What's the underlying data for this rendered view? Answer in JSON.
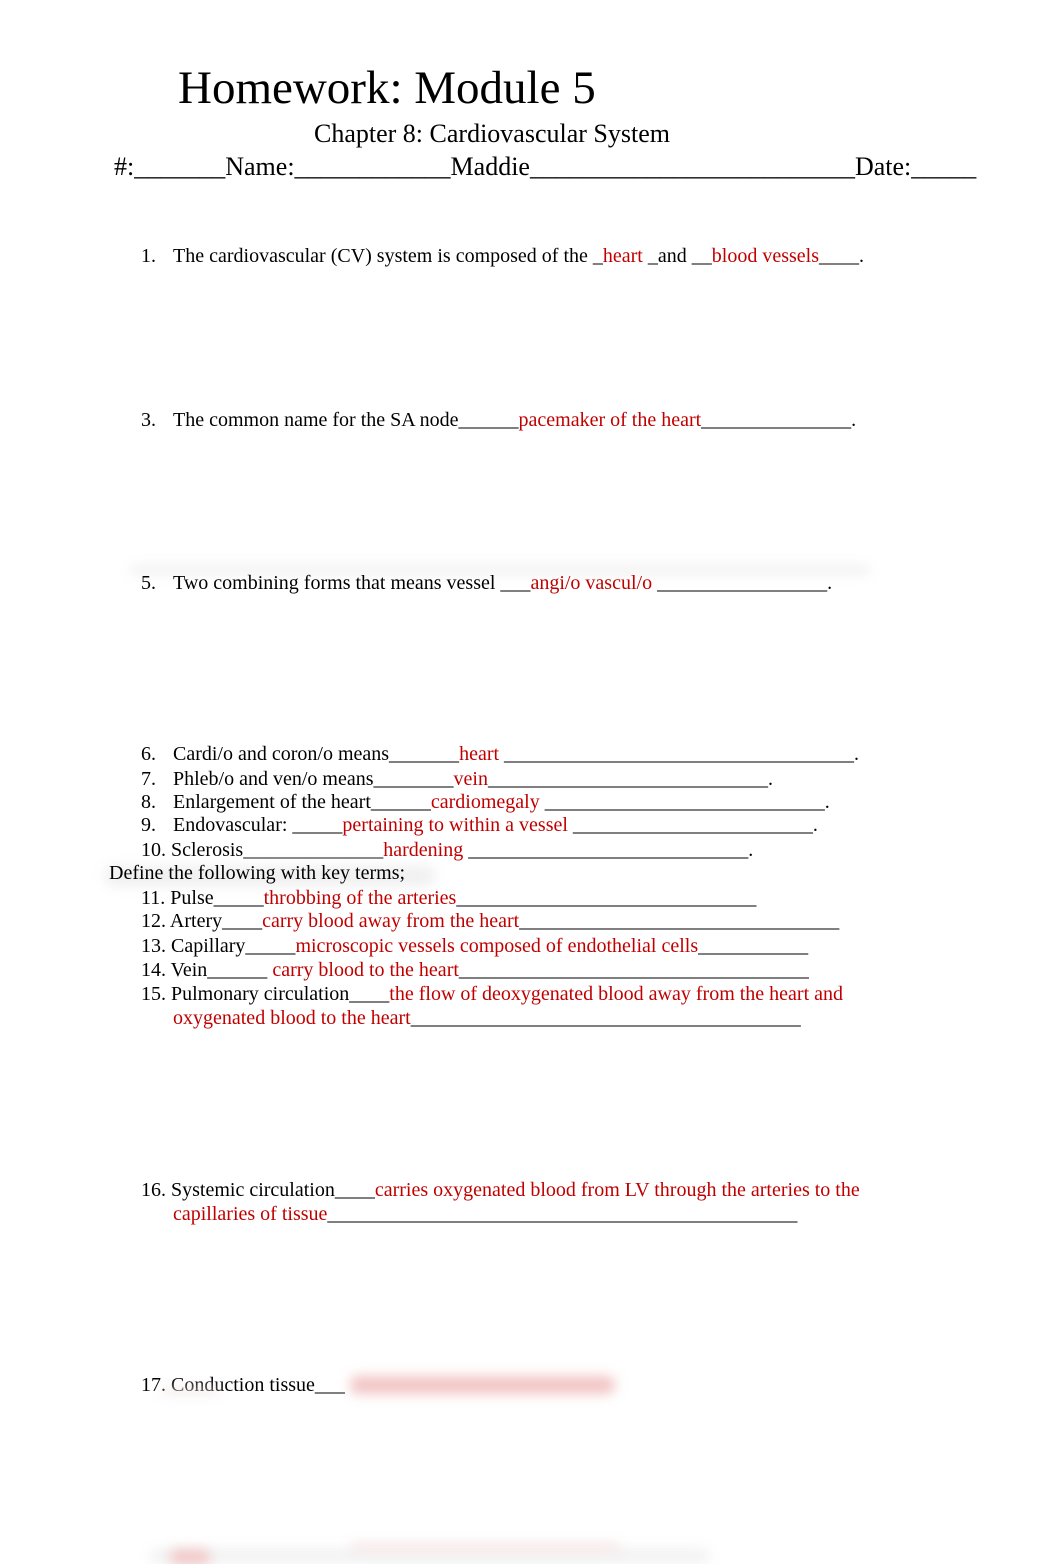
{
  "document": {
    "title": "Homework: Module 5",
    "subtitle": "Chapter 8: Cardiovascular System",
    "header": {
      "num_label": "#:",
      "num_blank": "_______",
      "name_label": "Name:",
      "name_blank_pre": "____________",
      "name_value": "Maddie",
      "name_blank_post": "_________________________",
      "date_label": "Date:",
      "date_blank": "_____"
    },
    "section_label": "Define the following with key terms;",
    "questions": [
      {
        "num": "1.",
        "parts": [
          "The cardiovascular (CV) system is composed of the _",
          "heart",
          " _and __",
          "blood vessels",
          "____."
        ]
      },
      {
        "num": "3.",
        "parts": [
          "The common name for the SA node______",
          "pacemaker of the heart",
          "_______________."
        ]
      },
      {
        "num": "5.",
        "parts": [
          "Two combining forms that means vessel ___",
          "angi/o vascul/o",
          " _________________."
        ]
      },
      {
        "num": "6.",
        "parts": [
          "Cardi/o and coron/o means_______",
          "heart",
          " ___________________________________."
        ]
      },
      {
        "num": "7.",
        "parts": [
          "Phleb/o and ven/o means________",
          "vein",
          "____________________________."
        ]
      },
      {
        "num": "8.",
        "parts": [
          "Enlargement of the heart______",
          "cardiomegaly",
          " ____________________________."
        ]
      },
      {
        "num": "9.",
        "parts": [
          "Endovascular: _____",
          "pertaining to within a vessel",
          " ________________________."
        ]
      },
      {
        "num": "10.",
        "parts": [
          "Sclerosis______________",
          "hardening",
          " ____________________________."
        ]
      },
      {
        "num": "11.",
        "parts": [
          "Pulse_____",
          "throbbing of the arteries",
          "______________________________"
        ]
      },
      {
        "num": "12.",
        "parts": [
          "Artery____",
          "carry blood away from the heart",
          "________________________________"
        ]
      },
      {
        "num": "13.",
        "parts": [
          "Capillary_____",
          "microscopic vessels composed of endothelial cells",
          "___________"
        ]
      },
      {
        "num": "14.",
        "parts": [
          "Vein______ ",
          "carry blood to the heart",
          "___________________________________"
        ]
      },
      {
        "num": "15.",
        "parts": [
          "Pulmonary circulation____",
          "the flow of deoxygenated blood away from the heart and"
        ],
        "cont": [
          "oxygenated blood to the heart",
          "_______________________________________"
        ]
      },
      {
        "num": "16.",
        "parts": [
          "Systemic circulation____",
          "carries oxygenated blood from LV through the arteries to the"
        ],
        "cont": [
          "capillaries of tissue",
          "_______________________________________________"
        ]
      },
      {
        "num": "17.",
        "parts": [
          "Conduction tissue___",
          ""
        ]
      }
    ]
  },
  "colors": {
    "answer": "#c00000",
    "text": "#000000"
  }
}
